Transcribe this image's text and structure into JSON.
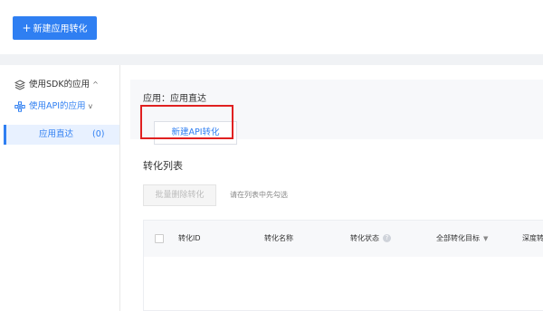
{
  "top": {
    "new_button_label": "新建应用转化",
    "new_button_plus": "+"
  },
  "sidebar": {
    "items": [
      {
        "label": "使用SDK的应用",
        "chevron": "^"
      },
      {
        "label": "使用API的应用",
        "chevron": "v"
      }
    ],
    "active_sub": {
      "label": "应用直达",
      "count": "(0)"
    }
  },
  "main": {
    "app_title": "应用：应用直达",
    "new_api_button": "新建API转化",
    "section_title": "转化列表",
    "batch_delete_button": "批量删除转化",
    "hint": "请在列表中先勾选",
    "table": {
      "headers": [
        "转化ID",
        "转化名称",
        "转化状态",
        "全部转化目标",
        "深度转"
      ]
    }
  },
  "colors": {
    "accent": "#2f7ff2",
    "highlight": "#e02020",
    "band": "#f0f2f5"
  }
}
